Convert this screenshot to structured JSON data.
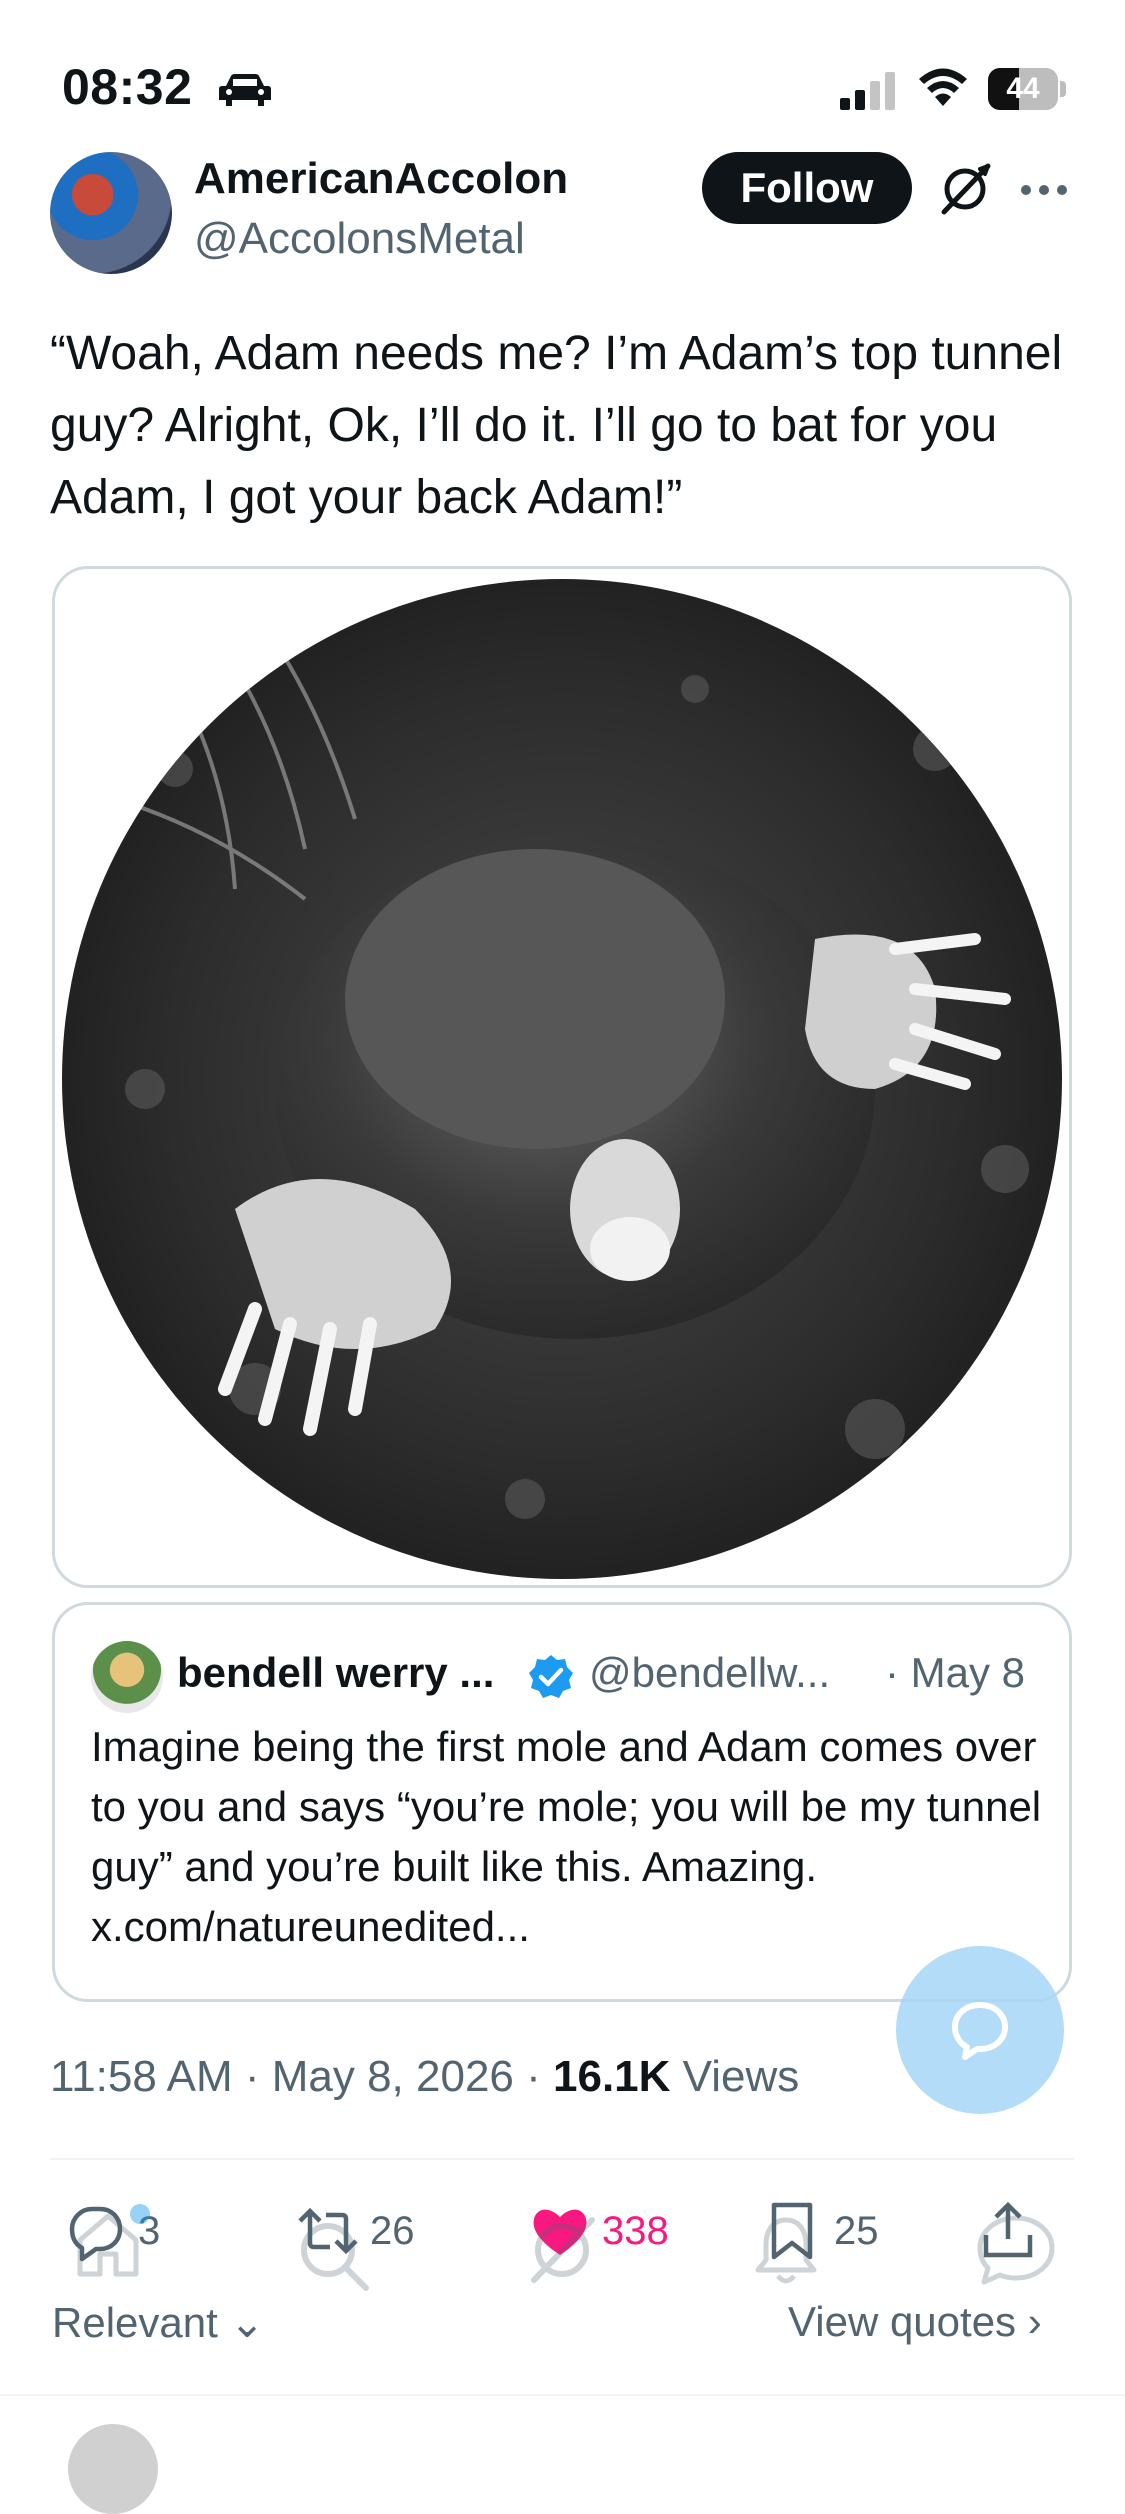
{
  "status_bar": {
    "time": "08:32",
    "battery": "44",
    "battery_level": 0.44
  },
  "author": {
    "display_name": "AmericanAccolon",
    "handle": "@AccolonsMetal",
    "follow_label": "Follow"
  },
  "tweet": {
    "text": "“Woah, Adam needs me? I’m Adam’s top tunnel guy? Alright, Ok, I’ll do it. I’ll go to bat for you Adam, I got your back Adam!”"
  },
  "quote": {
    "name": "bendell werry ...",
    "handle": "@bendellw...",
    "date": "· May 8",
    "text": "Imagine being the first mole and Adam comes over to you and says “you’re mole; you will be my tunnel guy” and you’re built like this. Amazing. x.com/natureunedited..."
  },
  "meta": {
    "time": "11:58 AM · May 8, 2026 · ",
    "views_count": "16.1K",
    "views_label": " Views"
  },
  "actions": {
    "replies": "3",
    "retweets": "26",
    "likes": "338",
    "bookmarks": "25"
  },
  "footer": {
    "sort_label": "Relevant",
    "view_quotes_label": "View quotes"
  },
  "colors": {
    "like": "#f91880",
    "verified": "#1d9bf0",
    "text_secondary": "#536471",
    "fab": "#a6d6f7"
  },
  "icons": [
    "car-icon",
    "signal-icon",
    "wifi-icon",
    "grok-icon",
    "more-icon",
    "verified-icon",
    "reply-icon",
    "retweet-icon",
    "heart-icon",
    "bookmark-icon",
    "share-icon",
    "home-icon",
    "search-icon",
    "bell-icon",
    "message-icon"
  ]
}
